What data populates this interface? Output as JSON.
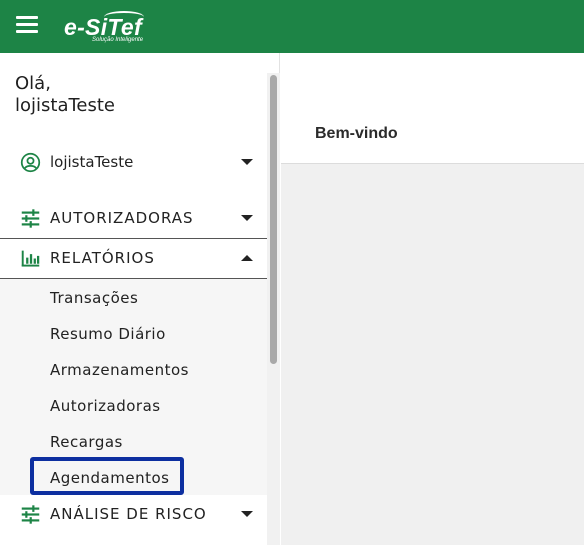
{
  "header": {
    "logo_text": "e-SiTef",
    "logo_tagline": "Solução Inteligente"
  },
  "sidebar": {
    "greeting_line1": "Olá,",
    "greeting_line2": "lojistaTeste",
    "user_menu_label": "lojistaTeste",
    "sections": [
      {
        "label": "AUTORIZADORAS",
        "icon": "sliders-icon",
        "expanded": false
      },
      {
        "label": "RELATÓRIOS",
        "icon": "bar-chart-icon",
        "expanded": true
      },
      {
        "label": "ANÁLISE DE RISCO",
        "icon": "sliders-icon",
        "expanded": false
      }
    ],
    "relatorios_items": [
      "Transações",
      "Resumo Diário",
      "Armazenamentos",
      "Autorizadoras",
      "Recargas",
      "Agendamentos"
    ],
    "highlighted_item": "Agendamentos"
  },
  "main": {
    "title": "Bem-vindo"
  },
  "colors": {
    "brand_green": "#1d8446",
    "highlight_blue": "#0d2fa0"
  }
}
